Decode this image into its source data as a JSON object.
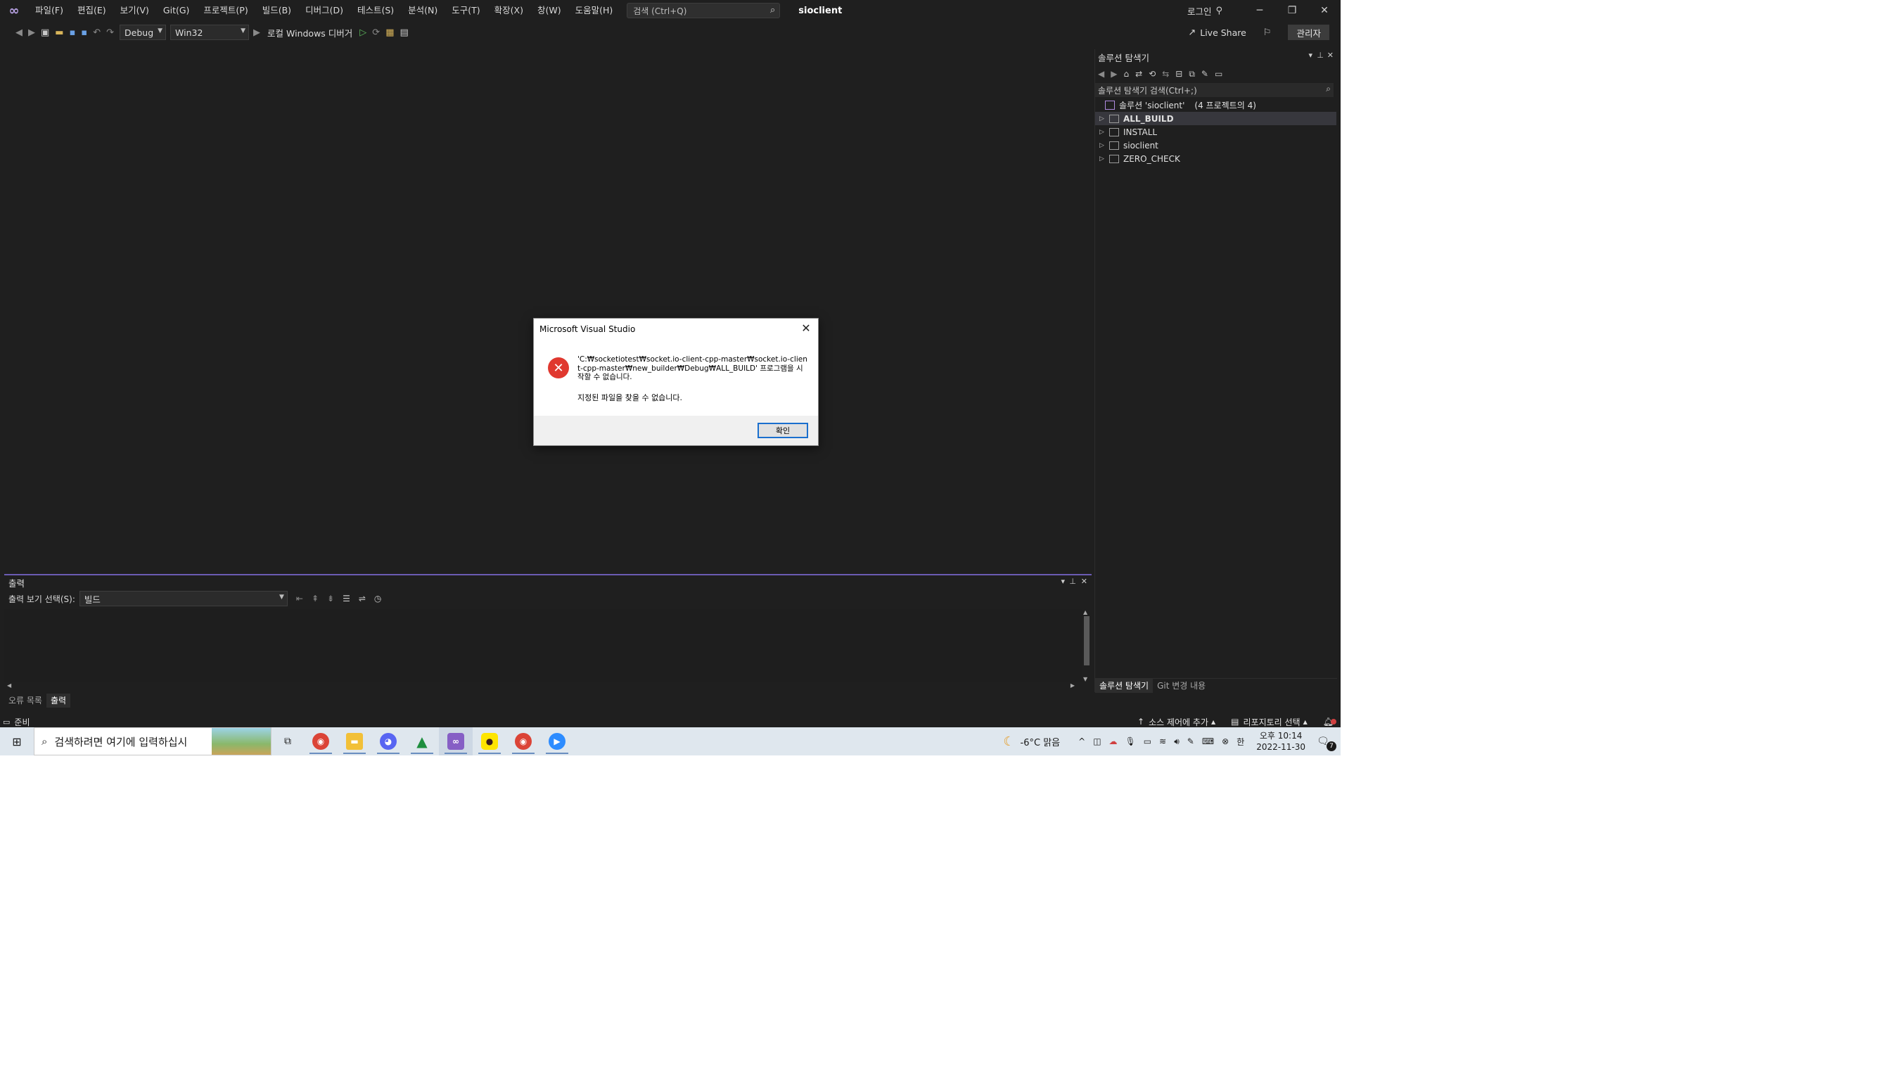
{
  "titlebar": {
    "menu": [
      "파일(F)",
      "편집(E)",
      "보기(V)",
      "Git(G)",
      "프로젝트(P)",
      "빌드(B)",
      "디버그(D)",
      "테스트(S)",
      "분석(N)",
      "도구(T)",
      "확장(X)",
      "창(W)",
      "도움말(H)"
    ],
    "search_placeholder": "검색 (Ctrl+Q)",
    "solution_name": "sioclient",
    "login": "로그인",
    "controls": {
      "minimize": "─",
      "restore": "❐",
      "close": "✕"
    }
  },
  "toolbar": {
    "configuration": "Debug",
    "platform": "Win32",
    "debug_target": "로컬 Windows 디버거",
    "live_share": "Live Share",
    "admin": "관리자"
  },
  "solution_explorer": {
    "title": "솔루션 탐색기",
    "search_placeholder": "솔루션 탐색기 검색(Ctrl+;)",
    "solution_label": "솔루션 'sioclient'",
    "solution_count": "(4 프로젝트의 4)",
    "projects": [
      "ALL_BUILD",
      "INSTALL",
      "sioclient",
      "ZERO_CHECK"
    ],
    "tabs": [
      "솔루션 탐색기",
      "Git 변경 내용"
    ]
  },
  "output": {
    "title": "출력",
    "show_from_label": "출력 보기 선택(S):",
    "show_from_value": "빌드",
    "tabs": [
      "오류 목록",
      "출력"
    ]
  },
  "statusbar": {
    "ready": "준비",
    "source_control": "소스 제어에 추가",
    "repository": "리포지토리 선택"
  },
  "dialog": {
    "title": "Microsoft Visual Studio",
    "message": "'C:₩socketiotest₩socket.io-client-cpp-master₩socket.io-client-cpp-master₩new_builder₩Debug₩ALL_BUILD' 프로그램을 시작할 수 없습니다.",
    "submessage": "지정된 파일을 찾을 수 없습니다.",
    "ok_button": "확인"
  },
  "taskbar": {
    "search_placeholder": "검색하려면 여기에 입력하십시",
    "weather": "-6°C 맑음",
    "ime": "한",
    "time": "오후 10:14",
    "date": "2022-11-30",
    "notification_count": "7"
  },
  "colors": {
    "window_bg": "#1f1f1f",
    "accent": "#6b5bb3",
    "dialog_error": "#e0382f",
    "dialog_button_border": "#1a6fce",
    "taskbar_bg": "#dfe7ee"
  }
}
